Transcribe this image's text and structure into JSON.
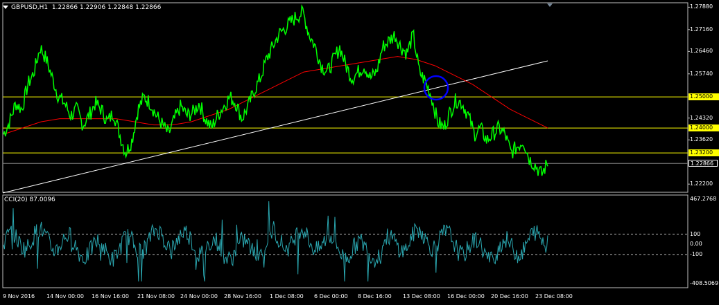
{
  "header": {
    "symbol": "GBPUSD,H1",
    "quote": "1.22866 1.22906 1.22848 1.22866"
  },
  "price_axis": {
    "labels": [
      "1.27880",
      "1.27160",
      "1.26460",
      "1.25740",
      "1.24320",
      "1.23620",
      "1.22200"
    ],
    "values": [
      1.2788,
      1.2716,
      1.2646,
      1.2574,
      1.2432,
      1.2362,
      1.222
    ],
    "range": [
      1.2196,
      1.28
    ]
  },
  "horizontal_lines": [
    {
      "label": "1.25000",
      "value": 1.25,
      "color": "#ffff00"
    },
    {
      "label": "1.24000",
      "value": 1.24,
      "color": "#ffff00"
    },
    {
      "label": "1.23200",
      "value": 1.232,
      "color": "#ffff00"
    }
  ],
  "current_price": {
    "label": "1.22866",
    "value": 1.22866
  },
  "indicator": {
    "header": "CCI(20) 87.0096",
    "max_label": "467.2768",
    "min_label": "-408.5069",
    "levels": [
      {
        "label": "100",
        "value": 100
      },
      {
        "label": "0.00",
        "value": 0
      },
      {
        "label": "-100",
        "value": -100
      }
    ],
    "range": [
      -408.5069,
      467.2768
    ],
    "color": "#2aa7b0"
  },
  "time_axis": {
    "labels": [
      "9 Nov 2016",
      "14 Nov 00:00",
      "16 Nov 16:00",
      "21 Nov 08:00",
      "24 Nov 00:00",
      "28 Nov 16:00",
      "1 Dec 08:00",
      "6 Dec 00:00",
      "8 Dec 16:00",
      "13 Dec 08:00",
      "16 Dec 00:00",
      "20 Dec 16:00",
      "23 Dec 08:00"
    ]
  },
  "colors": {
    "price": "#00ff00",
    "moving_average": "#ff0000",
    "trendline": "#ffffff",
    "circle": "#0000ff",
    "background": "#000000"
  },
  "chart_data": {
    "type": "line",
    "series": [
      {
        "values": [
          1.238,
          1.242,
          1.248,
          1.246,
          1.254,
          1.258,
          1.266,
          1.262,
          1.256,
          1.25,
          1.248,
          1.244,
          1.246,
          1.241,
          1.244,
          1.248,
          1.246,
          1.242,
          1.245,
          1.238,
          1.232,
          1.236,
          1.246,
          1.25,
          1.248,
          1.244,
          1.241,
          1.238,
          1.243,
          1.247,
          1.244,
          1.245,
          1.248,
          1.243,
          1.24,
          1.244,
          1.247,
          1.25,
          1.248,
          1.243,
          1.247,
          1.252,
          1.256,
          1.262,
          1.266,
          1.27,
          1.272,
          1.274,
          1.276,
          1.277,
          1.27,
          1.266,
          1.26,
          1.258,
          1.262,
          1.266,
          1.26,
          1.256,
          1.258,
          1.26,
          1.256,
          1.258,
          1.266,
          1.268,
          1.27,
          1.266,
          1.264,
          1.27,
          1.258,
          1.255,
          1.25,
          1.242,
          1.24,
          1.245,
          1.249,
          1.248,
          1.244,
          1.238,
          1.24,
          1.236,
          1.238,
          1.24,
          1.238,
          1.232,
          1.234,
          1.236,
          1.23,
          1.228,
          1.225,
          1.229
        ]
      },
      {
        "values": [
          1.238,
          1.24,
          1.242,
          1.243,
          1.243,
          1.243,
          1.243,
          1.242,
          1.241,
          1.241,
          1.242,
          1.244,
          1.246,
          1.249,
          1.252,
          1.255,
          1.258,
          1.259,
          1.26,
          1.261,
          1.262,
          1.263,
          1.262,
          1.26,
          1.257,
          1.254,
          1.25,
          1.246,
          1.243,
          1.24
        ]
      }
    ]
  }
}
